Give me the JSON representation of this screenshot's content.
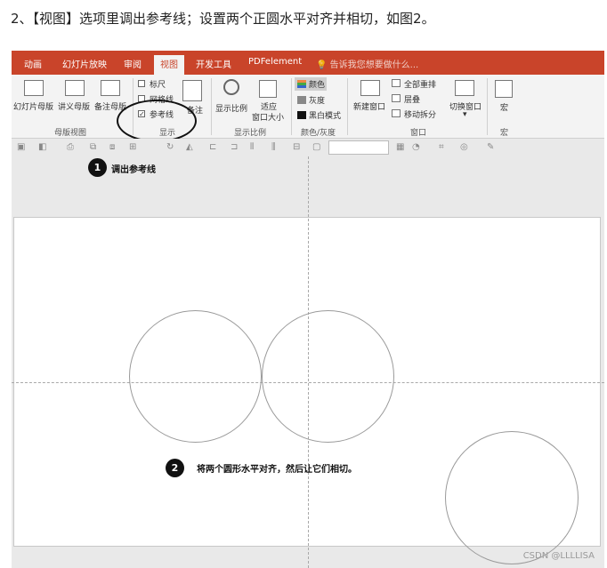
{
  "heading": "2、【视图】选项里调出参考线；设置两个正圆水平对齐并相切，如图2。",
  "ribbon_tabs": [
    "动画",
    "幻灯片放映",
    "审阅",
    "视图",
    "开发工具",
    "PDFelement"
  ],
  "active_tab": "视图",
  "tell_me": "告诉我您想要做什么...",
  "groups": {
    "master": {
      "label": "母版视图",
      "items": [
        "幻灯片母版",
        "讲义母版",
        "备注母版"
      ]
    },
    "show": {
      "label": "显示",
      "ruler": "标尺",
      "gridlines": "网格线",
      "guides": "参考线",
      "notes": "备注"
    },
    "zoom": {
      "label": "显示比例",
      "zoom": "显示比例",
      "fit_line1": "适应",
      "fit_line2": "窗口大小"
    },
    "color": {
      "label": "颜色/灰度",
      "items": [
        "颜色",
        "灰度",
        "黑白模式"
      ]
    },
    "window": {
      "label": "窗口",
      "new_window": "新建窗口",
      "arrange_all": "全部重排",
      "cascade": "层叠",
      "move_split": "移动拆分",
      "switch": "切换窗口"
    },
    "macro": {
      "label": "宏",
      "macro": "宏"
    }
  },
  "annotations": {
    "step1_number": "1",
    "step1_text": "调出参考线",
    "step2_number": "2",
    "step2_text": "将两个圆形水平对齐，然后让它们相切。"
  },
  "watermark": "CSDN @LLLLISA",
  "colors": {
    "ribbon_tab_bar": "#c9442a",
    "ribbon_body": "#f3f3f3",
    "workspace": "#e9e9e9",
    "guide": "#a9a9a9"
  }
}
